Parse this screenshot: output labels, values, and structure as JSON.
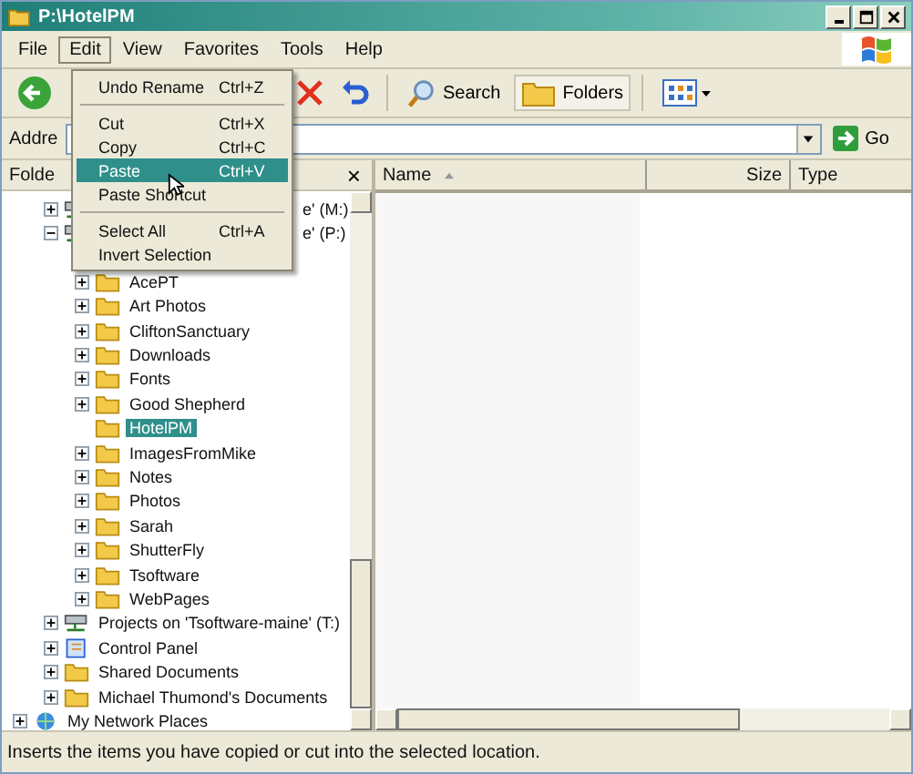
{
  "window": {
    "title": "P:\\HotelPM"
  },
  "menu_bar": [
    {
      "label": "File",
      "selected": false
    },
    {
      "label": "Edit",
      "selected": true
    },
    {
      "label": "View",
      "selected": false
    },
    {
      "label": "Favorites",
      "selected": false
    },
    {
      "label": "Tools",
      "selected": false
    },
    {
      "label": "Help",
      "selected": false
    }
  ],
  "edit_menu": [
    {
      "kind": "item",
      "label": "Undo Rename",
      "shortcut": "Ctrl+Z",
      "selected": false
    },
    {
      "kind": "separator"
    },
    {
      "kind": "item",
      "label": "Cut",
      "shortcut": "Ctrl+X",
      "selected": false
    },
    {
      "kind": "item",
      "label": "Copy",
      "shortcut": "Ctrl+C",
      "selected": false
    },
    {
      "kind": "item",
      "label": "Paste",
      "shortcut": "Ctrl+V",
      "selected": true
    },
    {
      "kind": "item",
      "label": "Paste Shortcut",
      "selected": false
    },
    {
      "kind": "separator"
    },
    {
      "kind": "item",
      "label": "Select All",
      "shortcut": "Ctrl+A",
      "selected": false
    },
    {
      "kind": "item",
      "label": "Invert Selection",
      "selected": false
    }
  ],
  "toolbar": {
    "search": "Search",
    "folders": "Folders"
  },
  "address_bar": {
    "label": "Addre",
    "go": "Go"
  },
  "folders_pane": {
    "title": "Folde",
    "close": "×"
  },
  "tree": [
    {
      "kind": "group",
      "children": [
        {
          "kind": "drive",
          "label": "e' (M:)",
          "expanded": false,
          "selected": false
        },
        {
          "kind": "drive",
          "label": "e' (P:)",
          "expanded": true,
          "selected": false,
          "children": [
            {
              "kind": "folder",
              "label": "AcePT",
              "expanded": false,
              "selected": false
            },
            {
              "kind": "folder",
              "label": "Art Photos",
              "expanded": false,
              "selected": false
            },
            {
              "kind": "folder",
              "label": "CliftonSanctuary",
              "expanded": false,
              "selected": false
            },
            {
              "kind": "folder",
              "label": "Downloads",
              "expanded": false,
              "selected": false
            },
            {
              "kind": "folder",
              "label": "Fonts",
              "expanded": false,
              "selected": false
            },
            {
              "kind": "folder",
              "label": "Good Shepherd",
              "expanded": false,
              "selected": false
            },
            {
              "kind": "folder",
              "label": "HotelPM",
              "selected": true
            },
            {
              "kind": "folder",
              "label": "ImagesFromMike",
              "expanded": false,
              "selected": false
            },
            {
              "kind": "folder",
              "label": "Notes",
              "expanded": false,
              "selected": false
            },
            {
              "kind": "folder",
              "label": "Photos",
              "expanded": false,
              "selected": false
            },
            {
              "kind": "folder",
              "label": "Sarah",
              "expanded": false,
              "selected": false
            },
            {
              "kind": "folder",
              "label": "ShutterFly",
              "expanded": false,
              "selected": false
            },
            {
              "kind": "folder",
              "label": "Tsoftware",
              "expanded": false,
              "selected": false
            },
            {
              "kind": "folder",
              "label": "WebPages",
              "expanded": false,
              "selected": false
            }
          ]
        },
        {
          "kind": "drive",
          "label": "Projects on 'Tsoftware-maine' (T:)",
          "expanded": false,
          "selected": false
        },
        {
          "kind": "control-panel",
          "label": "Control Panel",
          "expanded": false,
          "selected": false
        },
        {
          "kind": "folder",
          "label": "Shared Documents",
          "expanded": false,
          "selected": false
        },
        {
          "kind": "folder",
          "label": "Michael Thumond's Documents",
          "expanded": false,
          "selected": false
        }
      ]
    },
    {
      "kind": "network",
      "label": "My Network Places",
      "expanded": false,
      "selected": false
    }
  ],
  "columns": [
    {
      "label": "Name",
      "sorted": true
    },
    {
      "label": "Size",
      "sorted": false
    },
    {
      "label": "Type",
      "sorted": false
    }
  ],
  "status_bar": "Inserts the items you have copied or cut into the selected location."
}
